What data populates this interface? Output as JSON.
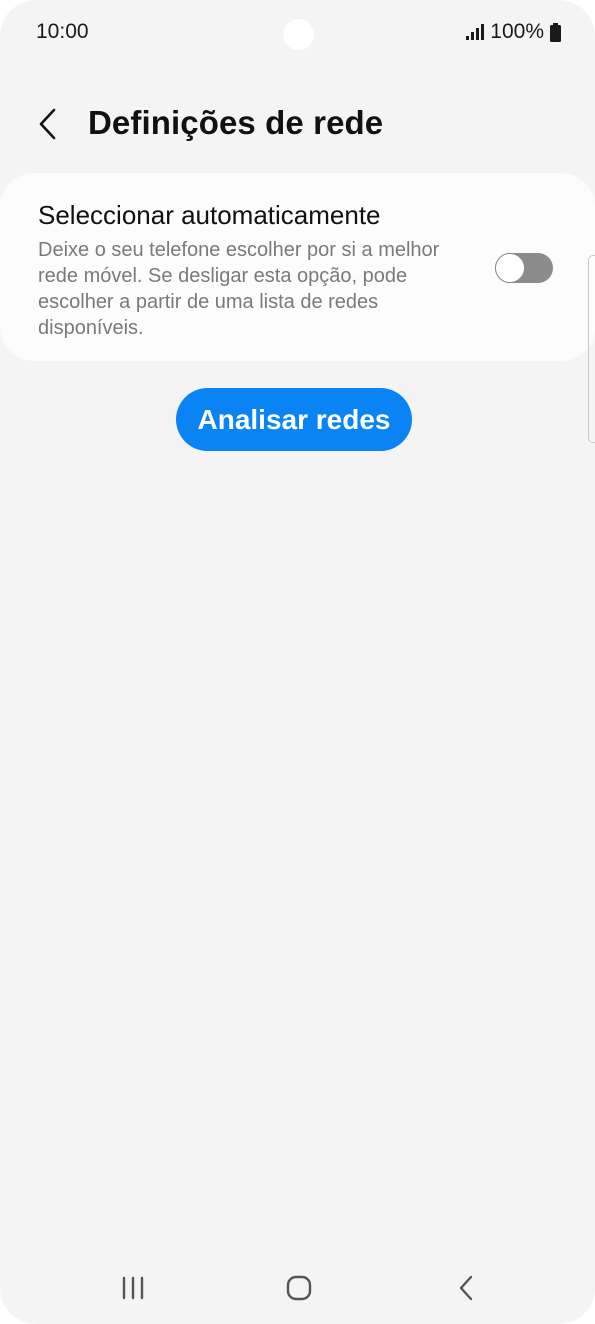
{
  "status_bar": {
    "time": "10:00",
    "battery": "100%"
  },
  "header": {
    "title": "Definições de rede",
    "back_icon": "chevron-left-icon"
  },
  "setting": {
    "title": "Seleccionar automaticamente",
    "description": "Deixe o seu telefone escolher por si a melhor rede móvel. Se desligar esta opção, pode escolher a partir de uma lista de redes disponíveis.",
    "toggle_on": false
  },
  "actions": {
    "analyze_label": "Analisar redes"
  },
  "nav_bar": {
    "recents_icon": "recents-icon",
    "home_icon": "home-icon",
    "back_icon": "back-icon"
  },
  "colors": {
    "background": "#f4f4f4",
    "card": "#fcfcfc",
    "accent": "#0a84f5",
    "toggle_off": "#8c8c8c",
    "text_primary": "#111111",
    "text_secondary": "#7a7a7a"
  }
}
